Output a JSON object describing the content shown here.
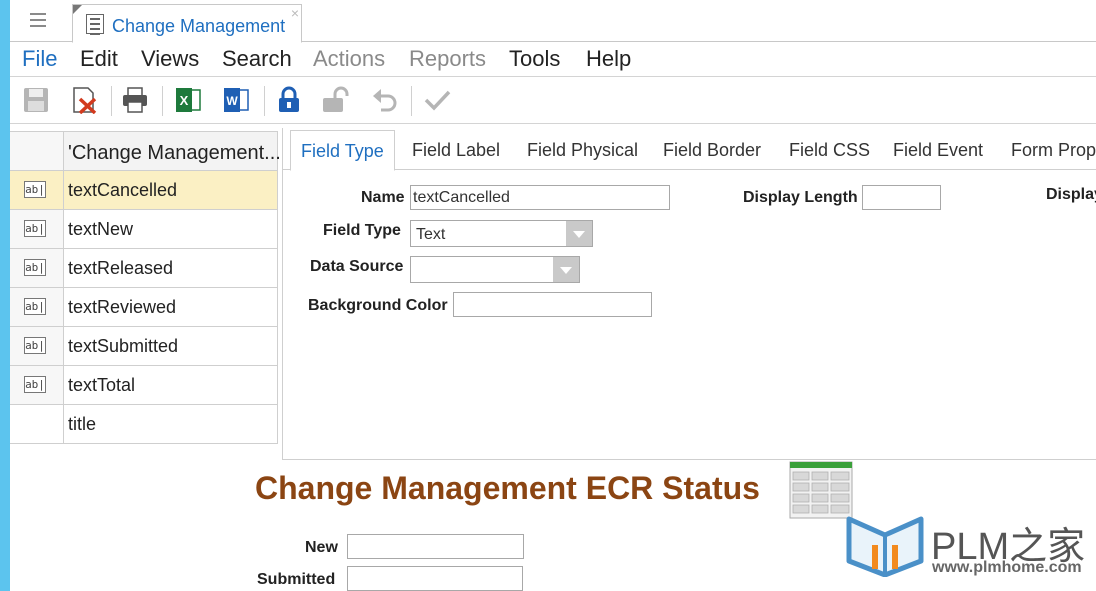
{
  "document_tab": {
    "title": "Change Management",
    "close_glyph": "×"
  },
  "menu": [
    {
      "label": "File",
      "color": "#1f6fc0"
    },
    {
      "label": "Edit",
      "color": "#222222"
    },
    {
      "label": "Views",
      "color": "#222222"
    },
    {
      "label": "Search",
      "color": "#222222"
    },
    {
      "label": "Actions",
      "color": "#8a8a8a"
    },
    {
      "label": "Reports",
      "color": "#8a8a8a"
    },
    {
      "label": "Tools",
      "color": "#222222"
    },
    {
      "label": "Help",
      "color": "#222222"
    }
  ],
  "toolbar": {
    "icons": [
      "save-icon",
      "delete-icon",
      "print-icon",
      "excel-icon",
      "word-icon",
      "lock-icon",
      "unlock-icon",
      "undo-icon",
      "done-icon"
    ],
    "excel_letter": "X",
    "word_letter": "W"
  },
  "field_list": {
    "header": "'Change Management...",
    "rows": [
      {
        "name": "textCancelled",
        "icon": "ab|",
        "selected": true
      },
      {
        "name": "textNew",
        "icon": "ab|"
      },
      {
        "name": "textReleased",
        "icon": "ab|"
      },
      {
        "name": "textReviewed",
        "icon": "ab|"
      },
      {
        "name": "textSubmitted",
        "icon": "ab|"
      },
      {
        "name": "textTotal",
        "icon": "ab|"
      },
      {
        "name": "title",
        "icon": ""
      }
    ]
  },
  "property_tabs": [
    "Field Type",
    "Field Label",
    "Field Physical",
    "Field Border",
    "Field CSS",
    "Field Event",
    "Form Prope"
  ],
  "properties": {
    "name_label": "Name",
    "name_value": "textCancelled",
    "display_length_label": "Display Length",
    "display_length_value": "",
    "display_cut_label": "Display",
    "field_type_label": "Field Type",
    "field_type_value": "Text",
    "data_source_label": "Data Source",
    "data_source_value": "",
    "background_color_label": "Background Color",
    "background_color_value": ""
  },
  "form_preview": {
    "title": "Change Management ECR Status",
    "title_color": "#8b4513",
    "fields": [
      {
        "label": "New",
        "value": ""
      },
      {
        "label": "Submitted",
        "value": ""
      }
    ]
  },
  "watermark": {
    "brand": "PLM之家",
    "url": "www.plmhome.com"
  },
  "colors": {
    "accent": "#1f6fc0",
    "selected_row": "#fbf0c4",
    "side_bar": "#5cc4ee"
  }
}
